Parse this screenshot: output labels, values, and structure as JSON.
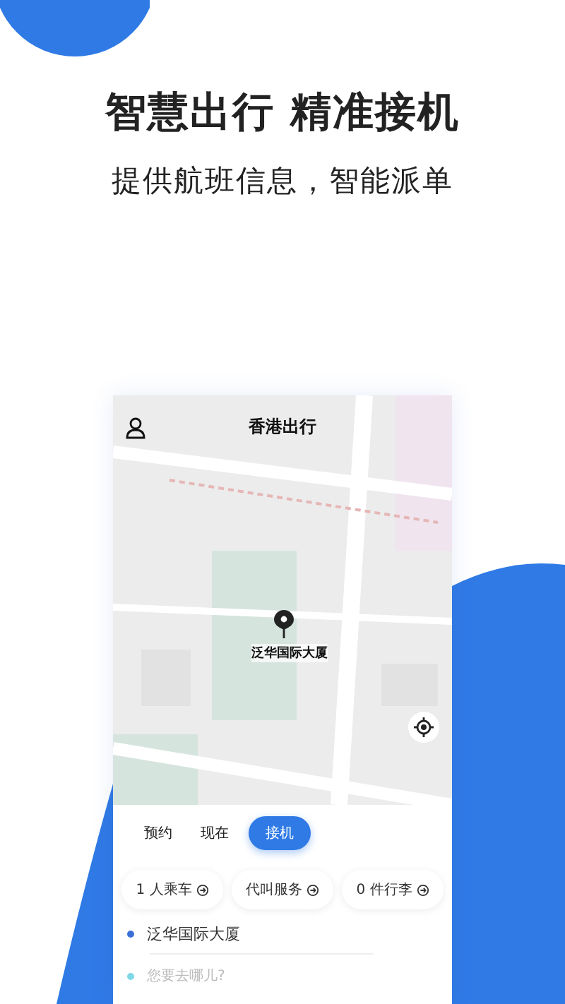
{
  "headline": "智慧出行 精准接机",
  "subtitle": "提供航班信息，智能派单",
  "app": {
    "title": "香港出行",
    "map": {
      "kind": "picture",
      "pin_label": "泛华国际大厦"
    },
    "modes": [
      {
        "label": "预约",
        "selected": false
      },
      {
        "label": "现在",
        "selected": false
      },
      {
        "label": "接机",
        "selected": true
      }
    ],
    "options": [
      {
        "label": "1 人乘车"
      },
      {
        "label": "代叫服务"
      },
      {
        "label": "0 件行李"
      }
    ],
    "start": {
      "value": "泛华国际大厦",
      "color": "#3a6fd8"
    },
    "destination": {
      "placeholder": "您要去哪儿?",
      "color": "#7fd8e8"
    }
  }
}
